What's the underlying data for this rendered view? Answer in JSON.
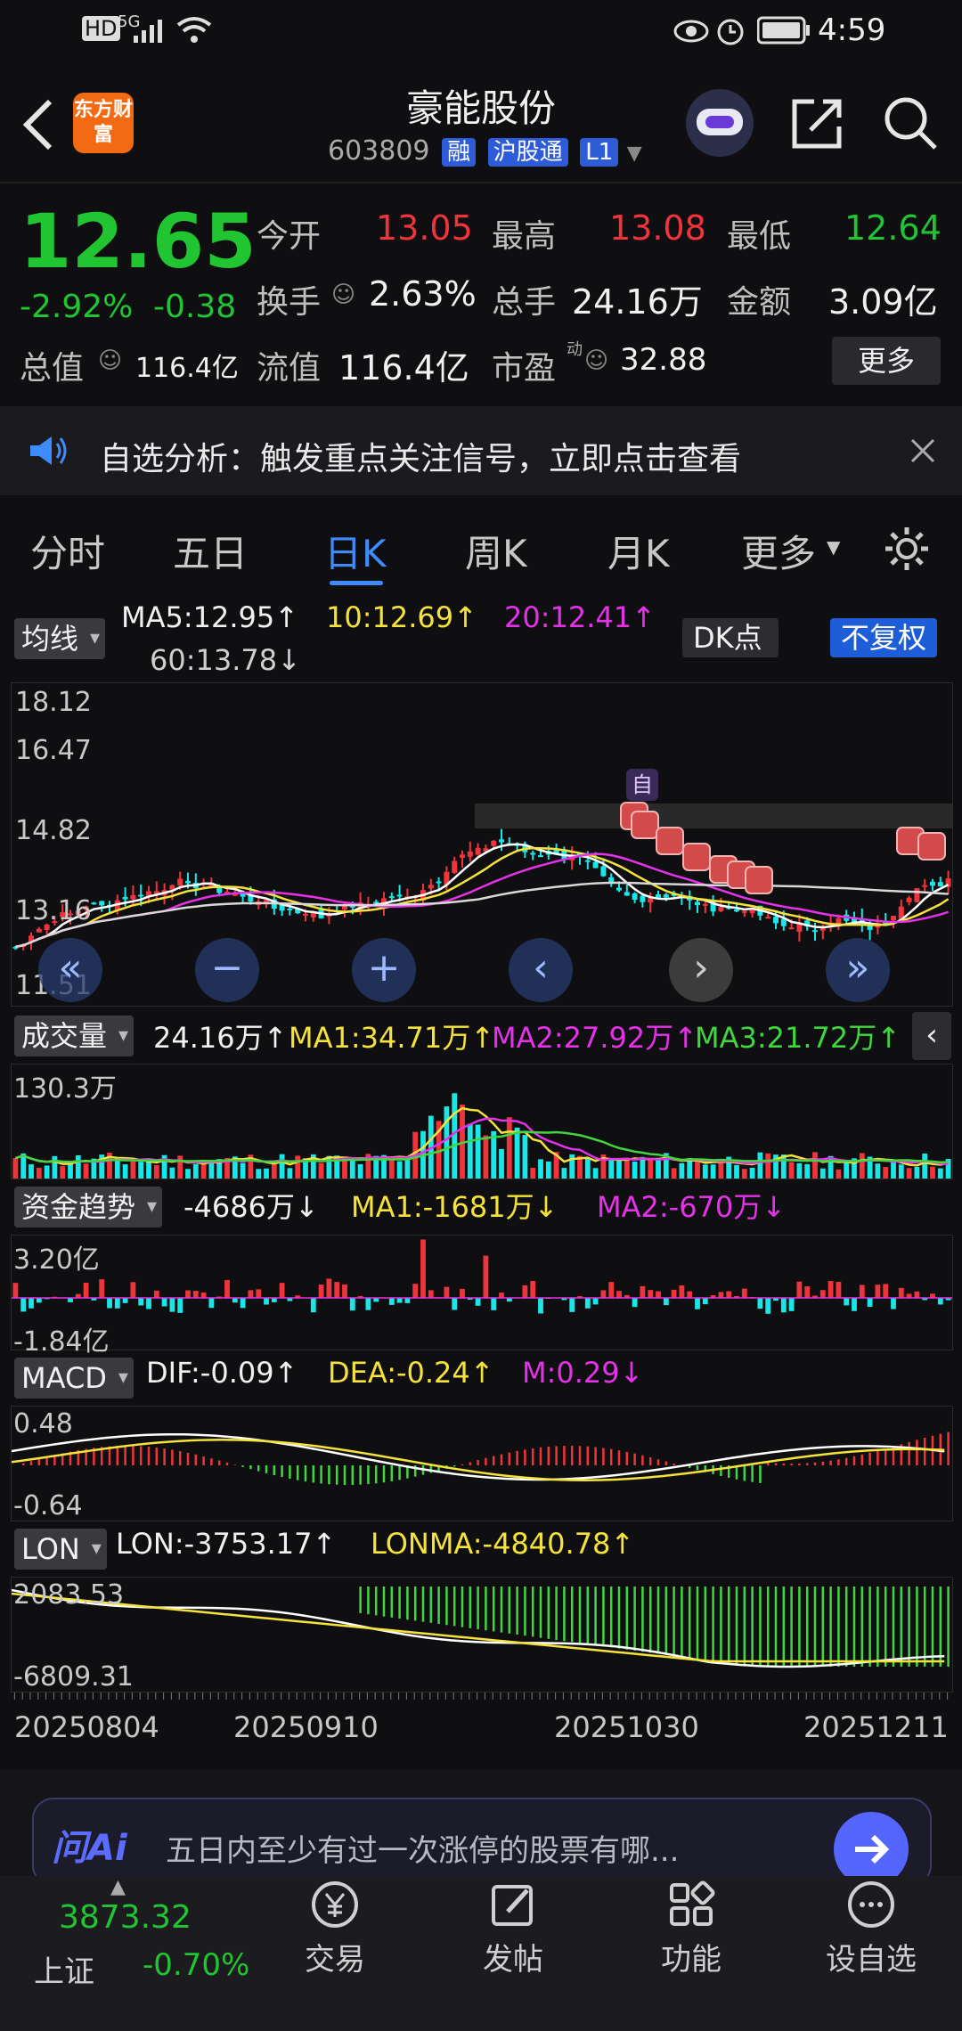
{
  "status": {
    "time": "4:59",
    "hd": "HD",
    "net": "5G"
  },
  "header": {
    "title": "豪能股份",
    "code": "603809",
    "badges": [
      "融",
      "沪股通",
      "L1"
    ],
    "logo": "东方财富"
  },
  "quote": {
    "price": "12.65",
    "change_pct": "-2.92%",
    "change": "-0.38",
    "open_label": "今开",
    "open": "13.05",
    "high_label": "最高",
    "high": "13.08",
    "low_label": "最低",
    "low": "12.64",
    "turnover_label": "换手",
    "turnover": "2.63%",
    "volume_label": "总手",
    "volume": "24.16万",
    "amount_label": "金额",
    "amount": "3.09亿",
    "mktcap_label": "总值",
    "mktcap": "116.4亿",
    "float_label": "流值",
    "float": "116.4亿",
    "pe_label": "市盈",
    "pe_sup": "动",
    "pe": "32.88",
    "more": "更多"
  },
  "notice": {
    "text": "自选分析：触发重点关注信号，立即点击查看"
  },
  "tabs": [
    "分时",
    "五日",
    "日K",
    "周K",
    "月K",
    "更多"
  ],
  "active_tab": 2,
  "kline": {
    "selector": "均线",
    "ma5": "MA5:12.95↑",
    "ma10": "10:12.69↑",
    "ma20": "20:12.41↑",
    "ma60": "60:13.78↓",
    "dk": "DK点",
    "fq": "不复权",
    "y_labels": [
      "18.12",
      "16.47",
      "14.82",
      "13.16",
      "11.51"
    ],
    "self_tag": "自"
  },
  "volume": {
    "selector": "成交量",
    "value": "24.16万↑",
    "ma1": "MA1:34.71万↑",
    "ma2": "MA2:27.92万↑",
    "ma3": "MA3:21.72万↑",
    "y_label": "130.3万"
  },
  "fund": {
    "selector": "资金趋势",
    "value": "-4686万↓",
    "ma1": "MA1:-1681万↓",
    "ma2": "MA2:-670万↓",
    "y_top": "3.20亿",
    "y_bottom": "-1.84亿"
  },
  "macd": {
    "selector": "MACD",
    "dif": "DIF:-0.09↑",
    "dea": "DEA:-0.24↑",
    "m": "M:0.29↓",
    "y_top": "0.48",
    "y_bottom": "-0.64"
  },
  "lon": {
    "selector": "LON",
    "lon": "LON:-3753.17↑",
    "lonma": "LONMA:-4840.78↑",
    "y_top": "2083.53",
    "y_bottom": "-6809.31"
  },
  "dates": [
    "20250804",
    "20250910",
    "20251030",
    "20251211"
  ],
  "ai_bar": {
    "logo": "问Ai",
    "text": "五日内至少有过一次涨停的股票有哪..."
  },
  "index": {
    "value": "3873.32",
    "name": "上证",
    "change": "-0.70%"
  },
  "nav": [
    "交易",
    "发帖",
    "功能",
    "设自选"
  ],
  "colors": {
    "up": "#f0343b",
    "down": "#21c431",
    "accent": "#2e5bd8",
    "bg": "#0f0f11"
  }
}
